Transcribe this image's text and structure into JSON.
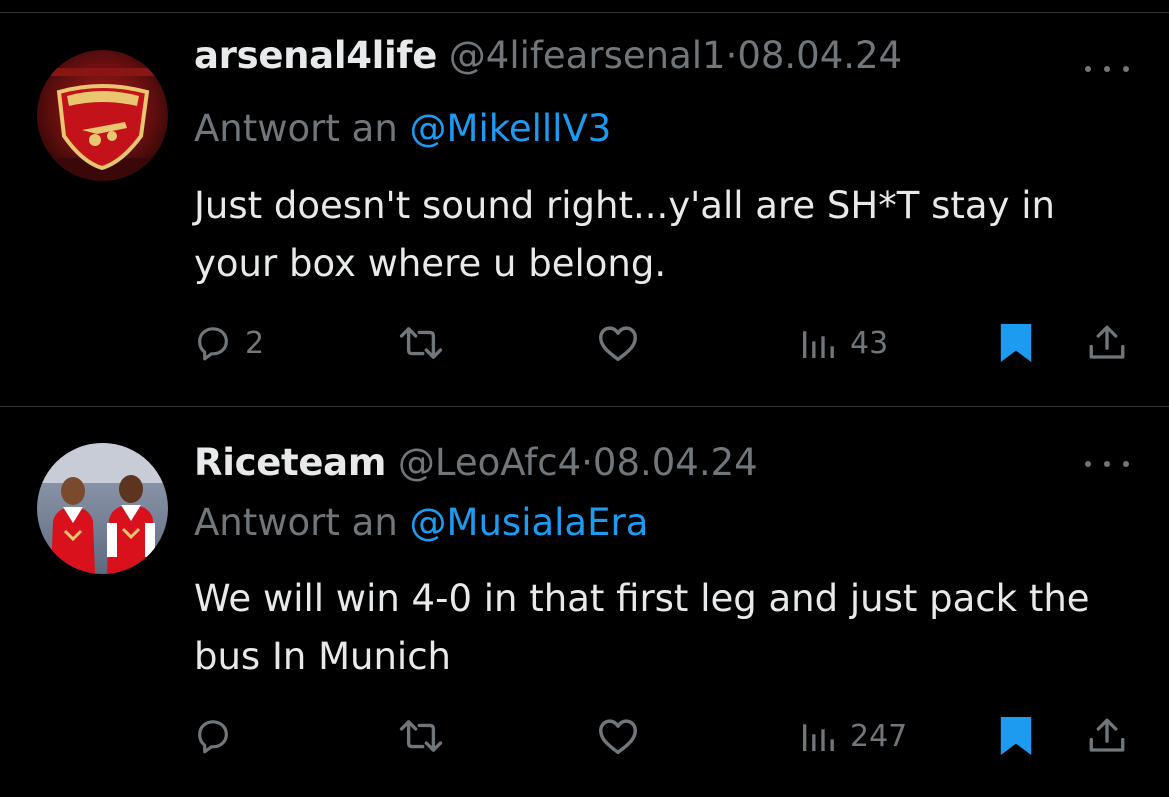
{
  "tweets": [
    {
      "display_name": "arsenal4life",
      "handle": "@4lifearsenal1",
      "separator": "·",
      "date": "08.04.24",
      "reply_prefix": "Antwort an",
      "reply_to": "@MikelllV3",
      "text": "Just doesn't sound right...y'all are SH*T stay in your box where u belong.",
      "replies": "2",
      "views": "43",
      "avatar_icon": "arsenal-crest-icon"
    },
    {
      "display_name": "Riceteam",
      "handle": "@LeoAfc4",
      "separator": "·",
      "date": "08.04.24",
      "reply_prefix": "Antwort an",
      "reply_to": "@MusialaEra",
      "text": "We will win 4-0 in that first leg and just pack the bus In Munich",
      "replies": "",
      "views": "247",
      "avatar_icon": "players-photo-icon"
    }
  ],
  "colors": {
    "background": "#000000",
    "text": "#e7e9ea",
    "muted": "#71767b",
    "accent": "#1d9bf0",
    "divider": "#2f3336"
  },
  "icons": [
    "reply-icon",
    "retweet-icon",
    "like-icon",
    "views-icon",
    "bookmark-icon",
    "share-icon",
    "more-icon"
  ]
}
